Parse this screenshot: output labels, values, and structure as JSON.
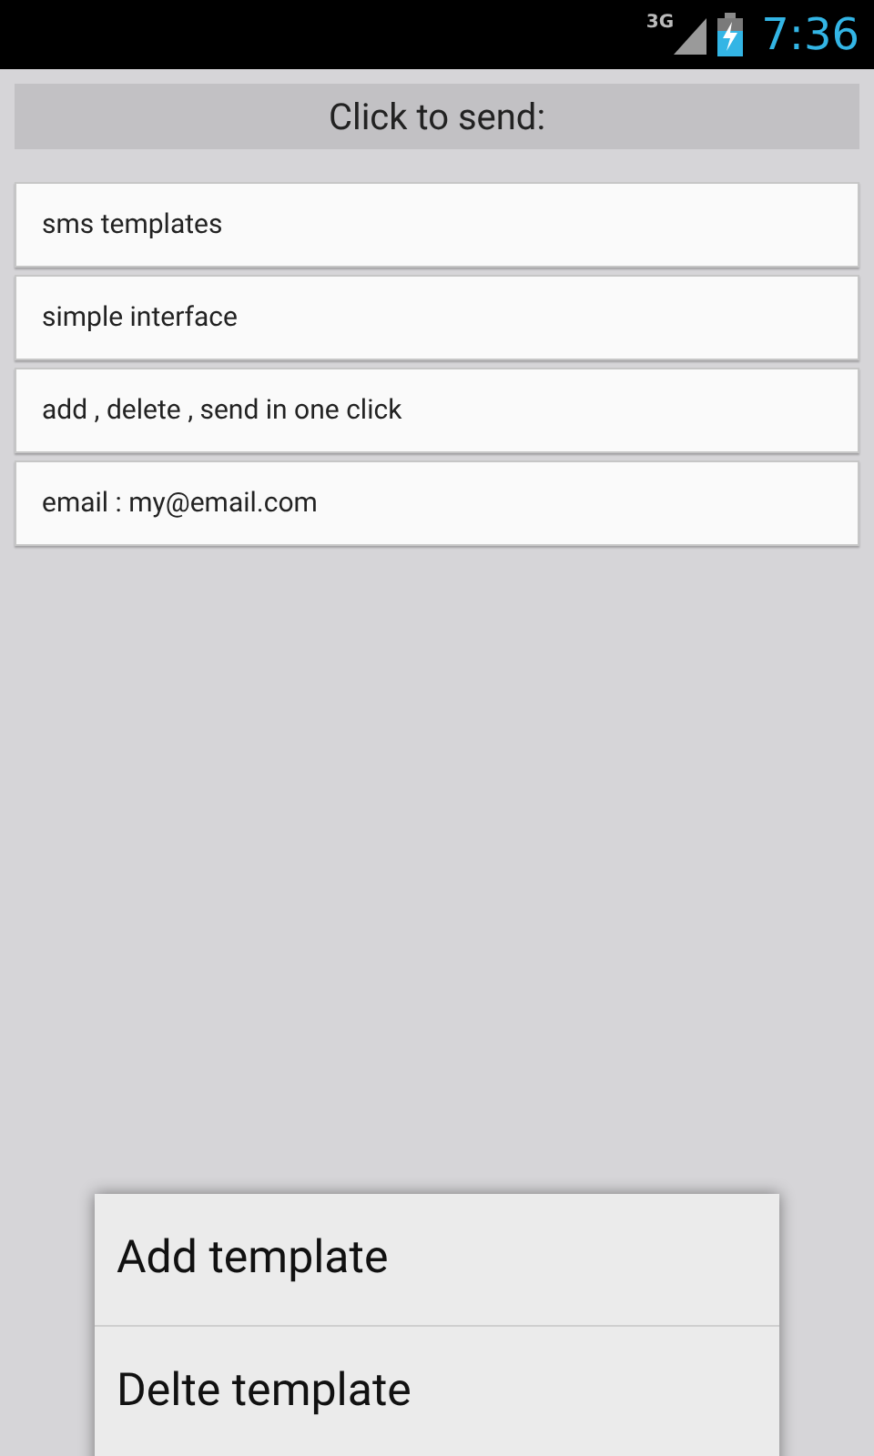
{
  "status_bar": {
    "network": "3G",
    "time": "7:36"
  },
  "header": {
    "title": "Click to send:"
  },
  "templates": [
    {
      "text": "sms templates"
    },
    {
      "text": "simple interface"
    },
    {
      "text": "add , delete , send in one click"
    },
    {
      "text": "email : my@email.com"
    }
  ],
  "menu": {
    "items": [
      {
        "label": "Add template"
      },
      {
        "label": "Delte template"
      }
    ]
  }
}
